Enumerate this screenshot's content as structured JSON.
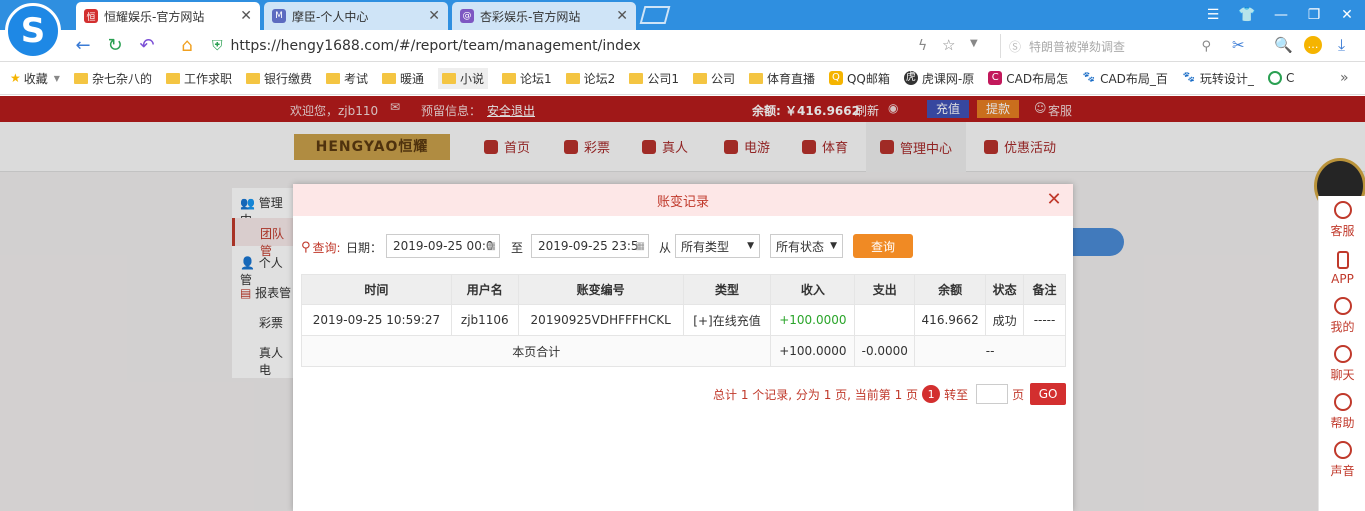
{
  "browser": {
    "tabs": [
      {
        "title": "恒耀娱乐-官方网站",
        "active": true
      },
      {
        "title": "摩臣-个人中心",
        "active": false
      },
      {
        "title": "杏彩娱乐-官方网站",
        "active": false
      }
    ],
    "url": "https://hengy1688.com/#/report/team/management/index",
    "search_placeholder": "特朗普被弹劾调查",
    "bookmarks": [
      "收藏",
      "杂七杂八的",
      "工作求职",
      "银行缴费",
      "考试",
      "暖通",
      "小说",
      "论坛1",
      "论坛2",
      "公司1",
      "公司",
      "体育直播",
      "QQ邮箱",
      "虎课网-原",
      "CAD布局怎",
      "CAD布局_百",
      "玩转设计_",
      "C"
    ]
  },
  "site": {
    "welcome": "欢迎您，zjb110",
    "alert_label": "预留信息：",
    "logout": "安全退出",
    "balance": "余额: ￥416.9662",
    "refresh": "刷新",
    "recharge": "充值",
    "withdraw": "提款",
    "service": "客服",
    "logo_text": "HENGYAO恒耀",
    "nav": [
      "首页",
      "彩票",
      "真人",
      "电游",
      "体育",
      "管理中心",
      "优惠活动"
    ],
    "sidebar": [
      "管理中",
      "团队管",
      "个人管",
      "报表管",
      "彩票",
      "真人电"
    ],
    "right_rail": [
      "客服",
      "APP",
      "我的",
      "聊天",
      "帮助",
      "声音"
    ]
  },
  "modal": {
    "title": "账变记录",
    "query_label": "查询:",
    "date_label": "日期：",
    "date_from": "2019-09-25 00:0",
    "to_label": "至",
    "date_to": "2019-09-25 23:5",
    "from_label": "从",
    "type_select": "所有类型",
    "status_select": "所有状态",
    "query_button": "查询",
    "columns": [
      "时间",
      "用户名",
      "账变编号",
      "类型",
      "收入",
      "支出",
      "余额",
      "状态",
      "备注"
    ],
    "rows": [
      [
        "2019-09-25 10:59:27",
        "zjb1106",
        "20190925VDHFFFHCKL",
        "[+]在线充值",
        "+100.0000",
        "",
        "416.9662",
        "成功",
        "-----"
      ]
    ],
    "total_label": "本页合计",
    "total_income": "+100.0000",
    "total_expense": "-0.0000",
    "total_balance": "--",
    "pager_text": "总计 1 个记录, 分为 1 页, 当前第 1 页",
    "current_page": "1",
    "goto_label": "转至",
    "page_label": "页",
    "go_button": "GO"
  },
  "colors": {
    "brand_red": "#b71c1c",
    "accent_orange": "#f08a24",
    "income_green": "#2aa52a"
  }
}
